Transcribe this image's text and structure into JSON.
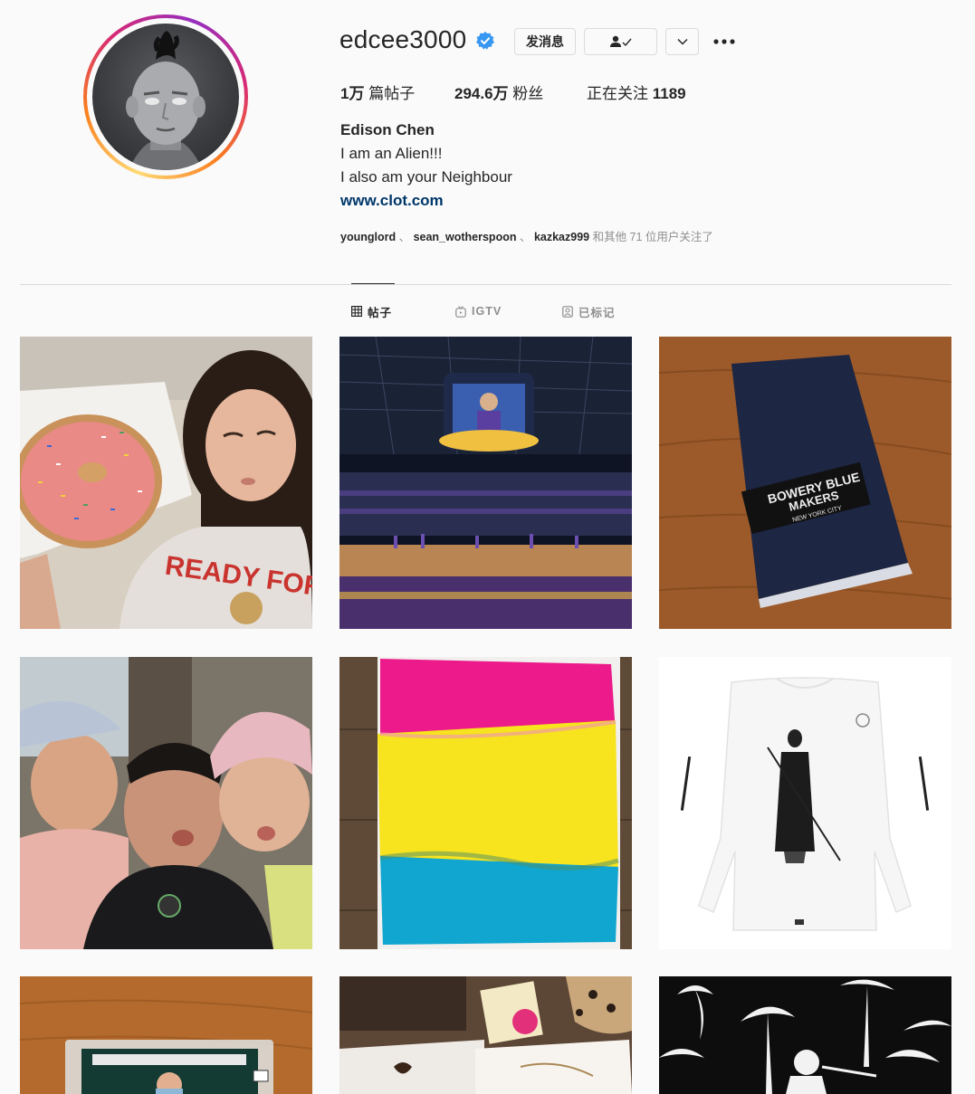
{
  "profile": {
    "username": "edcee3000",
    "verified": true,
    "avatar_icon": "avatar-photo",
    "full_name": "Edison Chen",
    "bio_line1": "I am an Alien!!!",
    "bio_line2": "I also am your Neighbour",
    "link": "www.clot.com"
  },
  "actions": {
    "message_label": "发消息",
    "follow_icon": "person-check-icon",
    "dropdown_icon": "chevron-down-icon",
    "more_icon": "more-options-icon"
  },
  "stats": {
    "posts_value": "1万",
    "posts_label": " 篇帖子",
    "followers_value": "294.6万",
    "followers_label": " 粉丝",
    "following_label": "正在关注 ",
    "following_value": "1189"
  },
  "followed_by": {
    "users": [
      "younglord",
      "sean_wotherspoon",
      "kazkaz999"
    ],
    "separator": " 、 ",
    "suffix": " 和其他 71 位用户关注了"
  },
  "tabs": [
    {
      "label": "帖子",
      "icon": "grid-icon",
      "active": true
    },
    {
      "label": "IGTV",
      "icon": "igtv-icon",
      "active": false
    },
    {
      "label": "已标记",
      "icon": "tagged-icon",
      "active": false
    }
  ],
  "posts": [
    {
      "id": 1,
      "image": "girl-with-sprinkled-donut",
      "text": "READY FOR"
    },
    {
      "id": 2,
      "image": "basketball-arena"
    },
    {
      "id": 3,
      "image": "denim-swatch-on-wood",
      "text_line1": "BOWERY BLUE",
      "text_line2": "MAKERS",
      "text_line3": "NEW YORK CITY"
    },
    {
      "id": 4,
      "image": "family-selfie-under-tree"
    },
    {
      "id": 5,
      "image": "pink-yellow-blue-painting"
    },
    {
      "id": 6,
      "image": "white-long-sleeve-shirt-samurai-print"
    },
    {
      "id": 7,
      "image": "trading-card-on-table"
    },
    {
      "id": 8,
      "image": "kids-drawings-and-boxes"
    },
    {
      "id": 9,
      "image": "black-white-palm-print"
    }
  ],
  "colors": {
    "text": "#262626",
    "muted": "#8e8e8e",
    "link": "#00376b",
    "verified": "#3897f0",
    "border": "#dbdbdb"
  }
}
